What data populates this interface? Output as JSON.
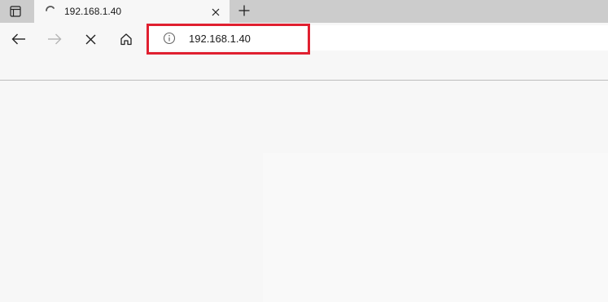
{
  "tab": {
    "title": "192.168.1.40",
    "loading": true
  },
  "address_bar": {
    "url": "192.168.1.40",
    "site_info_icon": "info-icon"
  },
  "toolbar": {
    "back_icon": "arrow-left-icon",
    "forward_icon": "arrow-right-icon",
    "forward_enabled": false,
    "stop_icon": "close-icon",
    "home_icon": "home-icon"
  },
  "colors": {
    "tabstrip": "#cccccc",
    "active_tab": "#f7f7f7",
    "highlight": "#e02030"
  }
}
